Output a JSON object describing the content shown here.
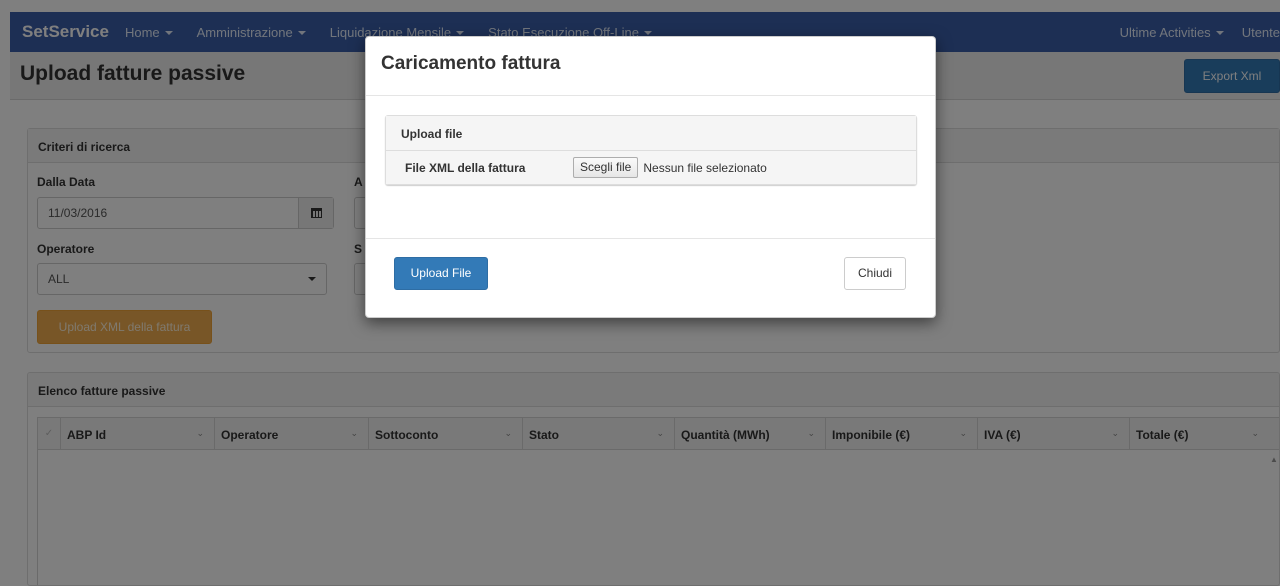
{
  "navbar": {
    "brand": "SetService",
    "left_items": [
      "Home",
      "Amministrazione",
      "Liquidazione Mensile",
      "Stato Esecuzione Off-Line"
    ],
    "right_items": [
      "Ultime Activities",
      "Utente"
    ],
    "color": "#3a5fa8"
  },
  "page": {
    "title": "Upload fatture passive",
    "export_label": "Export Xml"
  },
  "search": {
    "heading": "Criteri di ricerca",
    "dalla_data_label": "Dalla Data",
    "dalla_data_value": "11/03/2016",
    "second_date_label_initial": "A",
    "operatore_label": "Operatore",
    "operatore_value": "ALL",
    "second_select_label_initial": "S",
    "upload_xml_button": "Upload XML della fattura",
    "calendar_icon": "calendar-icon"
  },
  "grid": {
    "heading": "Elenco fatture passive",
    "columns": [
      "ABP Id",
      "Operatore",
      "Sottoconto",
      "Stato",
      "Quantità (MWh)",
      "Imponibile (€)",
      "IVA (€)",
      "Totale (€)"
    ]
  },
  "modal": {
    "title": "Caricamento fattura",
    "upload_heading": "Upload file",
    "file_label": "File XML della fattura",
    "choose_button": "Scegli file",
    "no_file_text": "Nessun file selezionato",
    "upload_button": "Upload File",
    "close_button": "Chiudi"
  },
  "colors": {
    "primary": "#337ab7",
    "warning": "#f0ad4e"
  }
}
